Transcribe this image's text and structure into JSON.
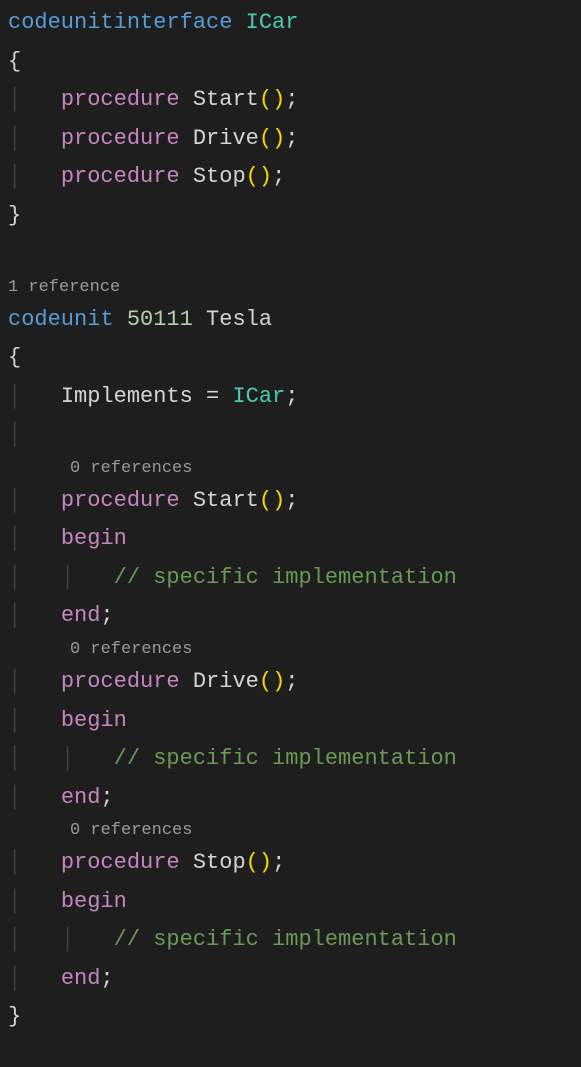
{
  "interface": {
    "keyword": "codeunitinterface",
    "name": "ICar",
    "procKeyword": "procedure",
    "procs": {
      "p1": "Start",
      "p2": "Drive",
      "p3": "Stop"
    }
  },
  "codelens": {
    "one": "1 reference",
    "zero": "0 references"
  },
  "codeunit": {
    "keyword": "codeunit",
    "id": "50111",
    "name": "Tesla",
    "implementsKw": "Implements",
    "implementsEq": "=",
    "implementsType": "ICar",
    "procKeyword": "procedure",
    "beginKw": "begin",
    "endKw": "end",
    "comment": "// specific implementation",
    "procs": {
      "p1": "Start",
      "p2": "Drive",
      "p3": "Stop"
    }
  },
  "sym": {
    "openBrace": "{",
    "closeBrace": "}",
    "openParen": "(",
    "closeParen": ")",
    "semicolon": ";",
    "pipe": "│"
  }
}
